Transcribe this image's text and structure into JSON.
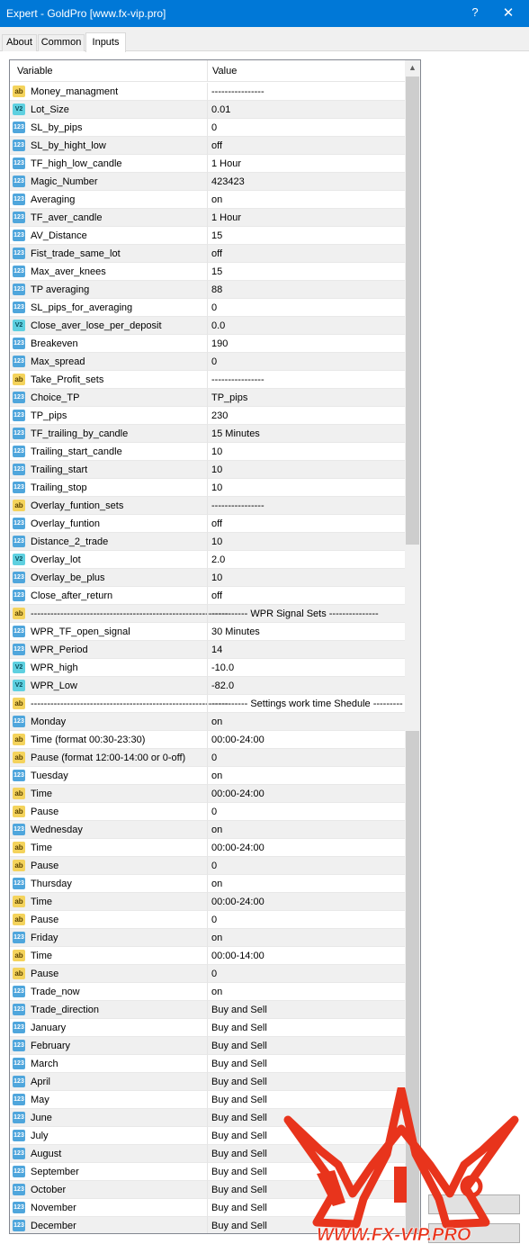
{
  "window": {
    "title": "Expert - GoldPro [www.fx-vip.pro]",
    "help_glyph": "?",
    "close_glyph": "✕"
  },
  "tabs": [
    {
      "label": "About"
    },
    {
      "label": "Common"
    },
    {
      "label": "Inputs",
      "active": true
    }
  ],
  "grid": {
    "header": {
      "variable": "Variable",
      "value": "Value"
    },
    "rows": [
      {
        "type": "ab",
        "name": "Money_managment",
        "value": "----------------"
      },
      {
        "type": "v2",
        "name": "Lot_Size",
        "value": "0.01"
      },
      {
        "type": "123",
        "name": "SL_by_pips",
        "value": "0"
      },
      {
        "type": "123",
        "name": "SL_by_hight_low",
        "value": "off"
      },
      {
        "type": "123",
        "name": "TF_high_low_candle",
        "value": "1 Hour"
      },
      {
        "type": "123",
        "name": "Magic_Number",
        "value": "423423"
      },
      {
        "type": "123",
        "name": "Averaging",
        "value": "on"
      },
      {
        "type": "123",
        "name": "TF_aver_candle",
        "value": "1 Hour"
      },
      {
        "type": "123",
        "name": "AV_Distance",
        "value": "15"
      },
      {
        "type": "123",
        "name": "Fist_trade_same_lot",
        "value": "off"
      },
      {
        "type": "123",
        "name": "Max_aver_knees",
        "value": "15"
      },
      {
        "type": "123",
        "name": "TP averaging",
        "value": "88"
      },
      {
        "type": "123",
        "name": "SL_pips_for_averaging",
        "value": "0"
      },
      {
        "type": "v2",
        "name": "Close_aver_lose_per_deposit",
        "value": "0.0"
      },
      {
        "type": "123",
        "name": "Breakeven",
        "value": "190"
      },
      {
        "type": "123",
        "name": "Max_spread",
        "value": "0"
      },
      {
        "type": "ab",
        "name": "Take_Profit_sets",
        "value": "----------------"
      },
      {
        "type": "123",
        "name": "Choice_TP",
        "value": "TP_pips"
      },
      {
        "type": "123",
        "name": "TP_pips",
        "value": "230"
      },
      {
        "type": "123",
        "name": "TF_trailing_by_candle",
        "value": "15 Minutes"
      },
      {
        "type": "123",
        "name": "Trailing_start_candle",
        "value": "10"
      },
      {
        "type": "123",
        "name": "Trailing_start",
        "value": "10"
      },
      {
        "type": "123",
        "name": "Trailing_stop",
        "value": "10"
      },
      {
        "type": "ab",
        "name": "Overlay_funtion_sets",
        "value": "----------------"
      },
      {
        "type": "123",
        "name": "Overlay_funtion",
        "value": "off"
      },
      {
        "type": "123",
        "name": "Distance_2_trade",
        "value": "10"
      },
      {
        "type": "v2",
        "name": "Overlay_lot",
        "value": "2.0"
      },
      {
        "type": "123",
        "name": "Overlay_be_plus",
        "value": "10"
      },
      {
        "type": "123",
        "name": "Close_after_return",
        "value": "off"
      },
      {
        "type": "ab",
        "name": "------------------------------------------------------------",
        "value": "----------- WPR Signal Sets ---------------"
      },
      {
        "type": "123",
        "name": "WPR_TF_open_signal",
        "value": "30 Minutes"
      },
      {
        "type": "123",
        "name": "WPR_Period",
        "value": "14"
      },
      {
        "type": "v2",
        "name": "WPR_high",
        "value": "-10.0"
      },
      {
        "type": "v2",
        "name": "WPR_Low",
        "value": "-82.0"
      },
      {
        "type": "ab",
        "name": "------------------------------------------------------------",
        "value": "----------- Settings work time Shedule -----------..."
      },
      {
        "type": "123",
        "name": "Monday",
        "value": "on"
      },
      {
        "type": "ab",
        "name": "Time (format 00:30-23:30)",
        "value": "00:00-24:00"
      },
      {
        "type": "ab",
        "name": "Pause (format 12:00-14:00 or 0-off)",
        "value": "0"
      },
      {
        "type": "123",
        "name": "Tuesday",
        "value": "on"
      },
      {
        "type": "ab",
        "name": "Time",
        "value": "00:00-24:00"
      },
      {
        "type": "ab",
        "name": "Pause",
        "value": "0"
      },
      {
        "type": "123",
        "name": "Wednesday",
        "value": "on"
      },
      {
        "type": "ab",
        "name": "Time",
        "value": "00:00-24:00"
      },
      {
        "type": "ab",
        "name": "Pause",
        "value": "0"
      },
      {
        "type": "123",
        "name": "Thursday",
        "value": "on"
      },
      {
        "type": "ab",
        "name": "Time",
        "value": "00:00-24:00"
      },
      {
        "type": "ab",
        "name": "Pause",
        "value": "0"
      },
      {
        "type": "123",
        "name": "Friday",
        "value": "on"
      },
      {
        "type": "ab",
        "name": "Time",
        "value": "00:00-14:00"
      },
      {
        "type": "ab",
        "name": "Pause",
        "value": "0"
      },
      {
        "type": "123",
        "name": "Trade_now",
        "value": "on"
      },
      {
        "type": "123",
        "name": "Trade_direction",
        "value": "Buy and Sell"
      },
      {
        "type": "123",
        "name": "January",
        "value": "Buy and Sell"
      },
      {
        "type": "123",
        "name": "February",
        "value": "Buy and Sell"
      },
      {
        "type": "123",
        "name": "March",
        "value": "Buy and Sell"
      },
      {
        "type": "123",
        "name": "April",
        "value": "Buy and Sell"
      },
      {
        "type": "123",
        "name": "May",
        "value": "Buy and Sell"
      },
      {
        "type": "123",
        "name": "June",
        "value": "Buy and Sell"
      },
      {
        "type": "123",
        "name": "July",
        "value": "Buy and Sell"
      },
      {
        "type": "123",
        "name": "August",
        "value": "Buy and Sell"
      },
      {
        "type": "123",
        "name": "September",
        "value": "Buy and Sell"
      },
      {
        "type": "123",
        "name": "October",
        "value": "Buy and Sell"
      },
      {
        "type": "123",
        "name": "November",
        "value": "Buy and Sell"
      },
      {
        "type": "123",
        "name": "December",
        "value": "Buy and Sell"
      }
    ]
  },
  "icon_labels": {
    "ab": "ab",
    "v2": "V2",
    "123": "123"
  },
  "icon_names": {
    "ab": "string-type-icon",
    "v2": "double-type-icon",
    "123": "integer-type-icon"
  },
  "watermark": {
    "text": "WWW.FX-VIP.PRO",
    "color": "#e8341c"
  },
  "colors": {
    "titlebar": "#0078d7",
    "alt_row": "#f0f0f0"
  }
}
